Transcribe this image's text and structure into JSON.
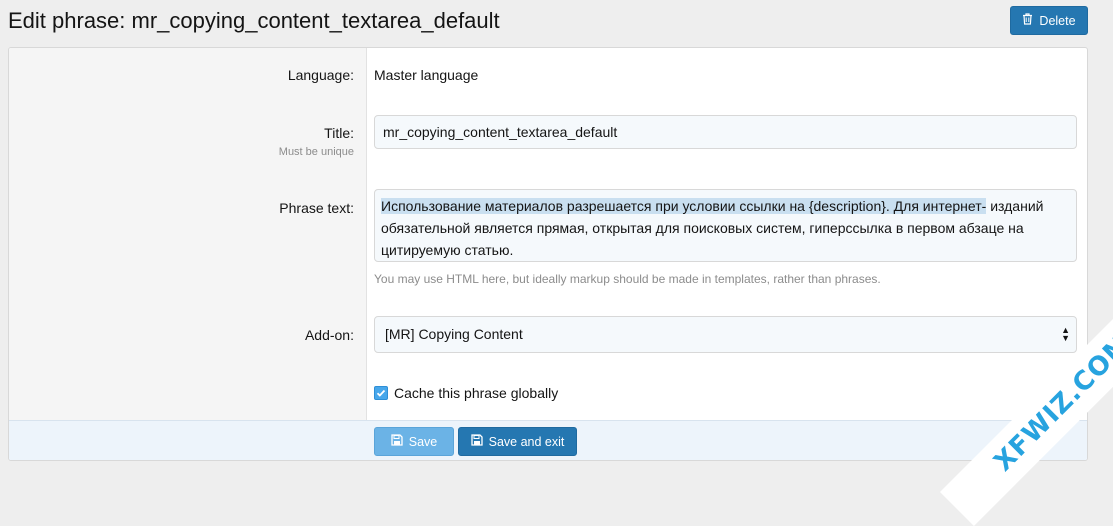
{
  "header": {
    "title": "Edit phrase: mr_copying_content_textarea_default",
    "delete_label": "Delete"
  },
  "form": {
    "language": {
      "label": "Language:",
      "value": "Master language"
    },
    "title": {
      "label": "Title:",
      "hint": "Must be unique",
      "value": "mr_copying_content_textarea_default"
    },
    "phrase_text": {
      "label": "Phrase text:",
      "value_highlighted": "Использование материалов разрешается при условии ссылки на {description}. Для интернет-",
      "value_rest": "изданий обязательной является прямая, открытая для поисковых систем, гиперссылка в первом абзаце на цитируемую статью.",
      "help": "You may use HTML here, but ideally markup should be made in templates, rather than phrases."
    },
    "addon": {
      "label": "Add-on:",
      "selected": "[MR] Copying Content"
    },
    "cache": {
      "label": "Cache this phrase globally",
      "checked": true
    }
  },
  "footer": {
    "save_label": "Save",
    "save_exit_label": "Save and exit"
  },
  "watermark": {
    "text": "XFWIZ.COM"
  },
  "colors": {
    "primary": "#2577b1",
    "primary_light": "#6bb3e6",
    "checkbox": "#47a7eb",
    "watermark": "#27a3df"
  }
}
